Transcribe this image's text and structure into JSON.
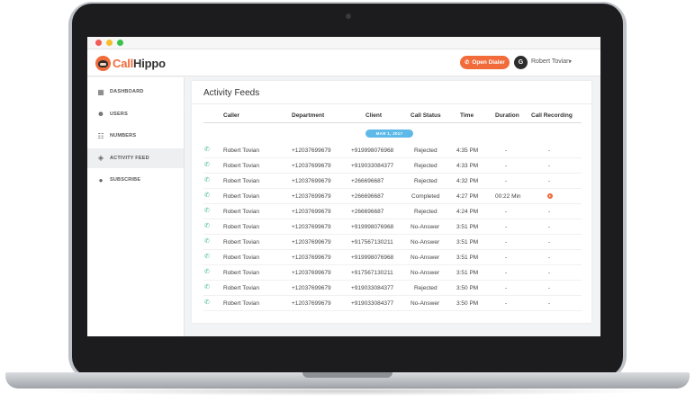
{
  "app": {
    "logo_prefix": "Call",
    "logo_suffix": "Hippo"
  },
  "header": {
    "dialer_label": "Open Dialer",
    "avatar_initial": "G",
    "user_name": "Robert Tovian"
  },
  "sidebar": {
    "items": [
      {
        "label": "DASHBOARD",
        "icon": "grid-icon"
      },
      {
        "label": "USERS",
        "icon": "users-icon"
      },
      {
        "label": "NUMBERS",
        "icon": "numbers-icon"
      },
      {
        "label": "ACTIVITY FEED",
        "icon": "activity-icon",
        "active": true
      },
      {
        "label": "SUBSCRIBE",
        "icon": "dollar-icon"
      }
    ]
  },
  "feed": {
    "title": "Activity Feeds",
    "columns": [
      "Caller",
      "Department",
      "Client",
      "Call Status",
      "Time",
      "Duration",
      "Call Recording"
    ],
    "date_label": "MAR 1, 2017",
    "rows": [
      {
        "caller": "Robert Tovian",
        "department": "+12037699679",
        "client": "+919998076968",
        "status": "Rejected",
        "time": "4:35 PM",
        "duration": "-",
        "recording": "-"
      },
      {
        "caller": "Robert Tovian",
        "department": "+12037699679",
        "client": "+919033084377",
        "status": "Rejected",
        "time": "4:33 PM",
        "duration": "-",
        "recording": "-"
      },
      {
        "caller": "Robert Tovian",
        "department": "+12037699679",
        "client": "+266696687",
        "status": "Rejected",
        "time": "4:32 PM",
        "duration": "-",
        "recording": "-"
      },
      {
        "caller": "Robert Tovian",
        "department": "+12037699679",
        "client": "+266696687",
        "status": "Completed",
        "time": "4:27 PM",
        "duration": "00:22 Min",
        "recording": "play"
      },
      {
        "caller": "Robert Tovian",
        "department": "+12037699679",
        "client": "+266696687",
        "status": "Rejected",
        "time": "4:24 PM",
        "duration": "-",
        "recording": "-"
      },
      {
        "caller": "Robert Tovian",
        "department": "+12037699679",
        "client": "+919998076968",
        "status": "No-Answer",
        "time": "3:51 PM",
        "duration": "-",
        "recording": "-"
      },
      {
        "caller": "Robert Tovian",
        "department": "+12037699679",
        "client": "+917567130211",
        "status": "No-Answer",
        "time": "3:51 PM",
        "duration": "-",
        "recording": "-"
      },
      {
        "caller": "Robert Tovian",
        "department": "+12037699679",
        "client": "+919998076968",
        "status": "No-Answer",
        "time": "3:51 PM",
        "duration": "-",
        "recording": "-"
      },
      {
        "caller": "Robert Tovian",
        "department": "+12037699679",
        "client": "+917567130211",
        "status": "No-Answer",
        "time": "3:51 PM",
        "duration": "-",
        "recording": "-"
      },
      {
        "caller": "Robert Tovian",
        "department": "+12037699679",
        "client": "+919033084377",
        "status": "Rejected",
        "time": "3:50 PM",
        "duration": "-",
        "recording": "-"
      },
      {
        "caller": "Robert Tovian",
        "department": "+12037699679",
        "client": "+919033084377",
        "status": "No-Answer",
        "time": "3:50 PM",
        "duration": "-",
        "recording": "-"
      }
    ]
  },
  "colors": {
    "brand": "#f26b3a",
    "date_pill": "#5db9e8",
    "call_icon": "#4ab89b"
  }
}
